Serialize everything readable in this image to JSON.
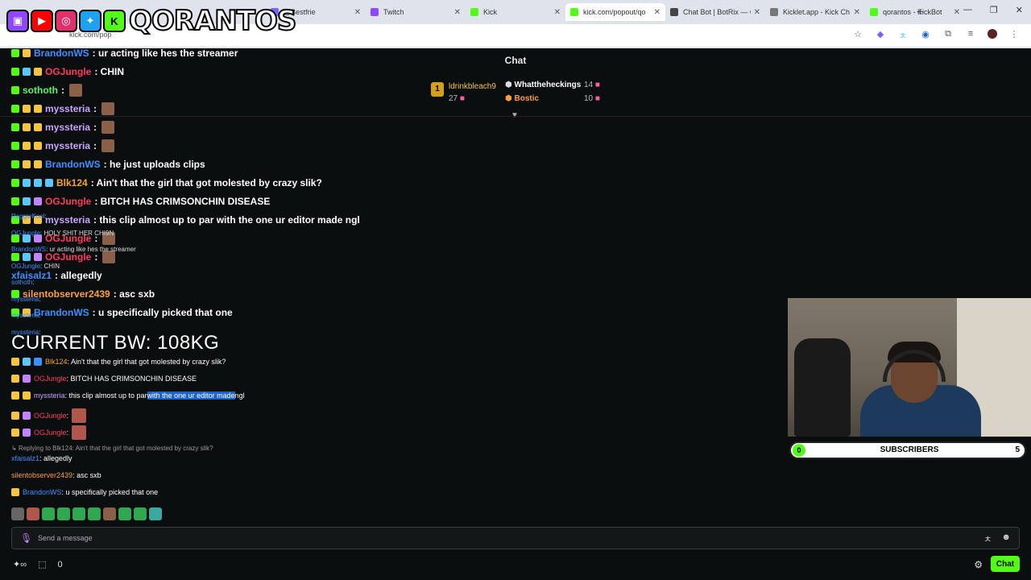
{
  "browser": {
    "tabs": [
      {
        "label": "@Bestfrie",
        "color": "#7b61ff"
      },
      {
        "label": "Twitch",
        "color": "#9146ff"
      },
      {
        "label": "Kick",
        "color": "#53fc18"
      },
      {
        "label": "kick.com/popout/qo",
        "color": "#53fc18",
        "active": true
      },
      {
        "label": "Chat Bot | BotRix — C",
        "color": "#444"
      },
      {
        "label": "Kicklet.app - Kick Ch",
        "color": "#777"
      },
      {
        "label": "qorantos - KickBot",
        "color": "#53fc18"
      }
    ],
    "url": "kick.com/pop",
    "logo_text": "QORANTOS"
  },
  "chat": {
    "header": "Chat",
    "leaderboard": {
      "rank": "1",
      "first_name": "ldrinkbleach9",
      "first_count": "27",
      "second_name": "Whattheheckings",
      "second_count": "14",
      "third_name": "Bostic",
      "third_count": "10"
    },
    "messages": [
      {
        "user": "BrandonWS",
        "text": ": ur acting like hes the streamer",
        "color": "#3f8fff"
      },
      {
        "user": "OGJungle",
        "text": ": CHIN",
        "color": "#ff3b5c"
      },
      {
        "user": "sothoth",
        "text": " : ",
        "color": "#5af56a"
      },
      {
        "user": "myssteria",
        "text": " : ",
        "color": "#c9a3ff"
      },
      {
        "user": "myssteria",
        "text": " : ",
        "color": "#c9a3ff"
      },
      {
        "user": "myssteria",
        "text": " : ",
        "color": "#c9a3ff"
      },
      {
        "user": "BrandonWS",
        "text": ": he just uploads clips",
        "color": "#3f8fff"
      },
      {
        "user": "Blk124",
        "text": ": Ain't that the girl that got molested by crazy slik?",
        "color": "#f5a623"
      },
      {
        "user": "OGJungle",
        "text": ": BITCH HAS CRIMSONCHIN DISEASE",
        "color": "#ff3b5c"
      },
      {
        "user": "myssteria",
        "text": ": this clip almost up to par with the one ur editor made ngl",
        "color": "#c9a3ff"
      },
      {
        "user": "OGJungle",
        "text": ": ",
        "color": "#ff3b5c"
      },
      {
        "user": "OGJungle",
        "text": ": ",
        "color": "#ff3b5c"
      },
      {
        "user": "xfaisalz1",
        "text": ": allegedly",
        "color": "#3f8fff"
      },
      {
        "user": "silentobserver2439",
        "text": ": asc sxb",
        "color": "#ff9e3d"
      },
      {
        "user": "BrandonWS",
        "text": ": u specifically picked that one",
        "color": "#3f8fff"
      }
    ],
    "overlay_lines": [
      {
        "user": "ReggieKool",
        "text": ":"
      },
      {
        "user": "OGJungle",
        "text": ": HOLY SHIT HER CHI9N"
      },
      {
        "user": "BrandonWS",
        "text": ": ur acting like hes the streamer"
      },
      {
        "user": "OGJungle",
        "text": ": CHIN"
      },
      {
        "user": "sothoth",
        "text": ":"
      },
      {
        "user": "myssteria",
        "text": ":"
      },
      {
        "user": "myssteria",
        "text": ":"
      },
      {
        "user": "myssteria",
        "text": ":"
      }
    ],
    "bw_text": "CURRENT BW: 108KG",
    "lower": [
      {
        "user": "Blk124",
        "text": ": Ain't that the girl that got molested by crazy slik?",
        "color": "#f5a623"
      },
      {
        "user": "OGJungle",
        "text": ": BITCH HAS CRIMSONCHIN DISEASE",
        "color": "#ff3b5c"
      },
      {
        "user": "myssteria",
        "text_a": ": this clip almost up to par ",
        "text_b": "with the one ur editor made",
        "text_c": " ngl",
        "color": "#c9a3ff"
      },
      {
        "user": "OGJungle",
        "text": ":",
        "color": "#ff3b5c"
      },
      {
        "user": "OGJungle",
        "text": ":",
        "color": "#ff3b5c"
      }
    ],
    "reply_text": "Replying to Blk124: Ain't that the girl that got molested by crazy slik?",
    "reply_user": "xfaisalz1",
    "reply_msg": ": allegedly",
    "silent_user": "silentobserver2439",
    "silent_msg": ": asc sxb",
    "last_user": "BrandonWS",
    "last_msg": ": u specifically picked that one",
    "input_placeholder": "Send a message",
    "bottom_count": "0",
    "chat_button": "Chat"
  },
  "subscribers": {
    "current": "0",
    "label": "SUBSCRIBERS",
    "goal": "5"
  }
}
